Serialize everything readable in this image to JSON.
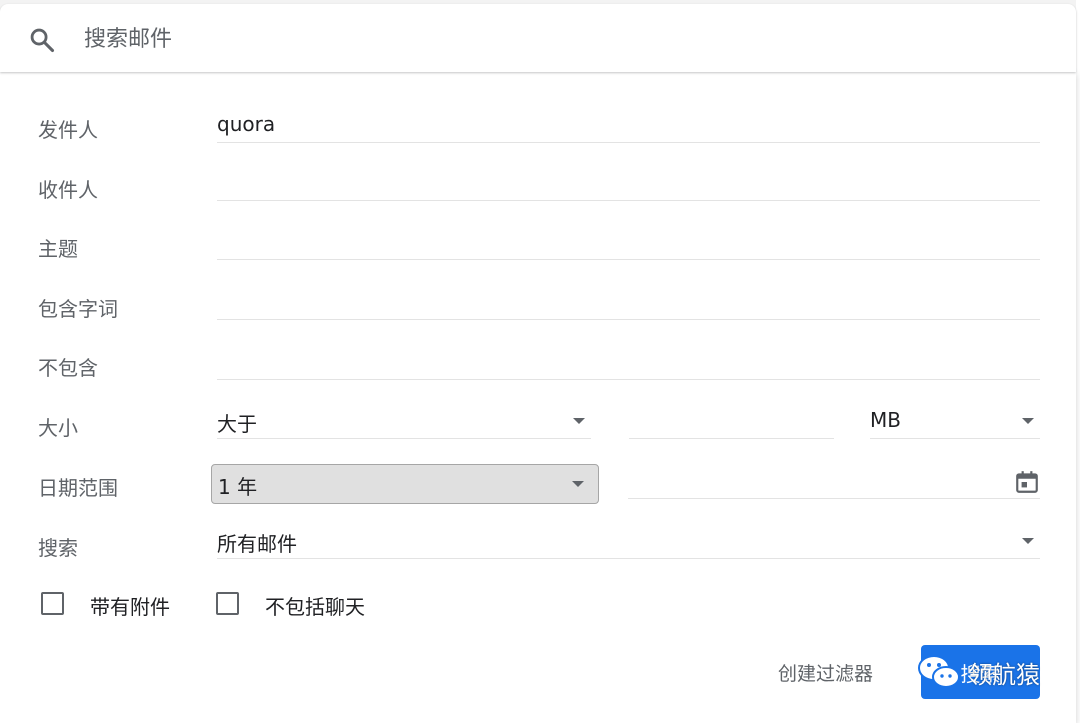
{
  "search": {
    "placeholder": "搜索邮件",
    "icon": "search-icon"
  },
  "form": {
    "from": {
      "label": "发件人",
      "value": "quora"
    },
    "to": {
      "label": "收件人",
      "value": ""
    },
    "subject": {
      "label": "主题",
      "value": ""
    },
    "has_words": {
      "label": "包含字词",
      "value": ""
    },
    "doesnt_have": {
      "label": "不包含",
      "value": ""
    },
    "size": {
      "label": "大小",
      "operator": "大于",
      "amount": "",
      "unit": "MB"
    },
    "date_range": {
      "label": "日期范围",
      "value": "1 年",
      "date": "",
      "icon": "calendar-icon"
    },
    "search_in": {
      "label": "搜索",
      "value": "所有邮件"
    },
    "has_attachment": {
      "label": "带有附件",
      "checked": false
    },
    "exclude_chats": {
      "label": "不包括聊天",
      "checked": false
    }
  },
  "actions": {
    "create_filter": "创建过滤器",
    "search_button": "搜索"
  },
  "watermark": {
    "text": "领航猿",
    "icon": "wechat-icon"
  },
  "colors": {
    "primary": "#1a73e8",
    "label": "#5f6368",
    "text": "#202124",
    "divider": "#e3e3e3",
    "selected_bg": "#e0e0e0"
  }
}
